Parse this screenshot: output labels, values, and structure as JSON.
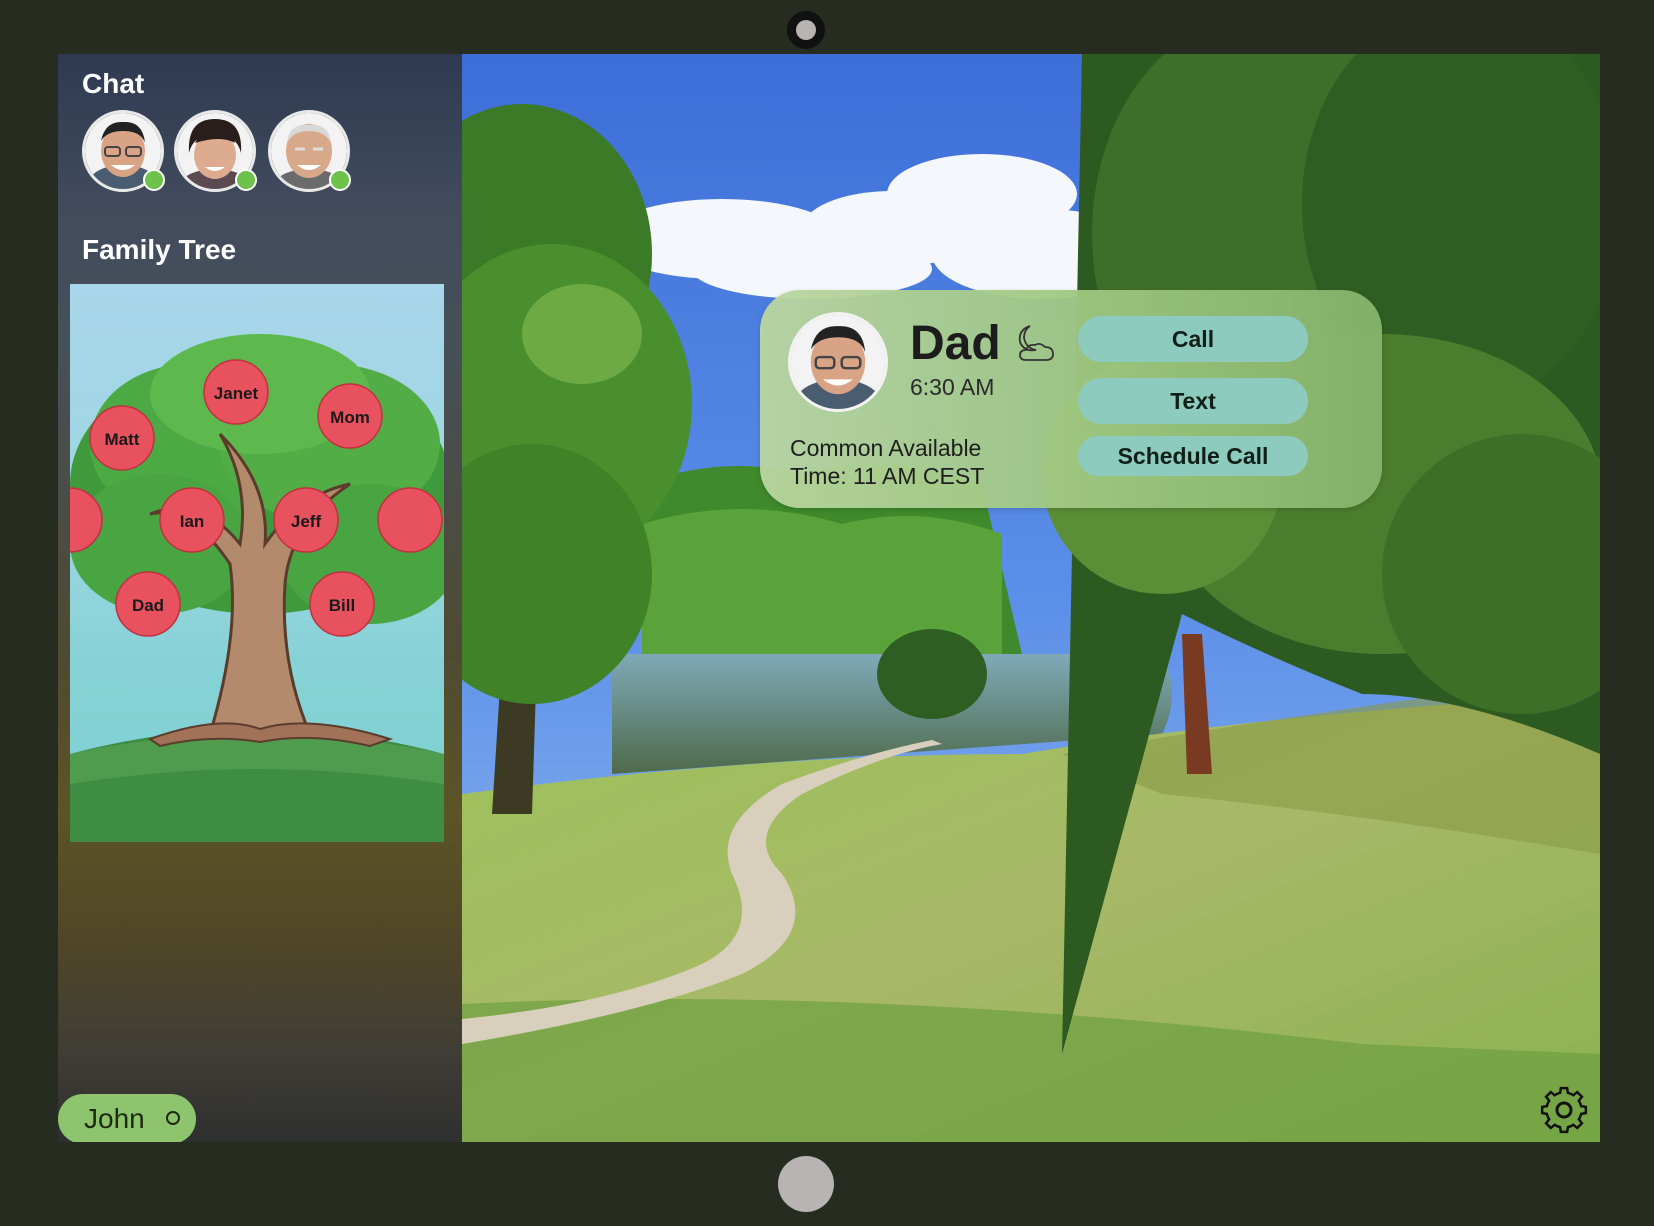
{
  "sidebar": {
    "chat_title": "Chat",
    "contacts": [
      {
        "icon": "avatar-man-glasses",
        "online": true
      },
      {
        "icon": "avatar-woman",
        "online": true
      },
      {
        "icon": "avatar-elderly-man",
        "online": true
      }
    ],
    "family_tree_title": "Family Tree",
    "family_tree": {
      "members": [
        "Janet",
        "Matt",
        "Mom",
        "Ian",
        "Jeff",
        "Dad",
        "Bill"
      ]
    },
    "user": {
      "name": "John",
      "status_icon": "status-ring-icon"
    }
  },
  "contact_card": {
    "name": "Dad",
    "local_time": "6:30 AM",
    "time_icon": "moon-cloud-icon",
    "availability": "Common Available Time: 11 AM CEST",
    "buttons": {
      "call": "Call",
      "text": "Text",
      "schedule": "Schedule Call"
    }
  },
  "settings_icon": "gear-icon",
  "colors": {
    "online": "#6cc24a",
    "button": "#8ecbbf",
    "user_pill": "#8dc46d",
    "card": "#a0c882"
  }
}
